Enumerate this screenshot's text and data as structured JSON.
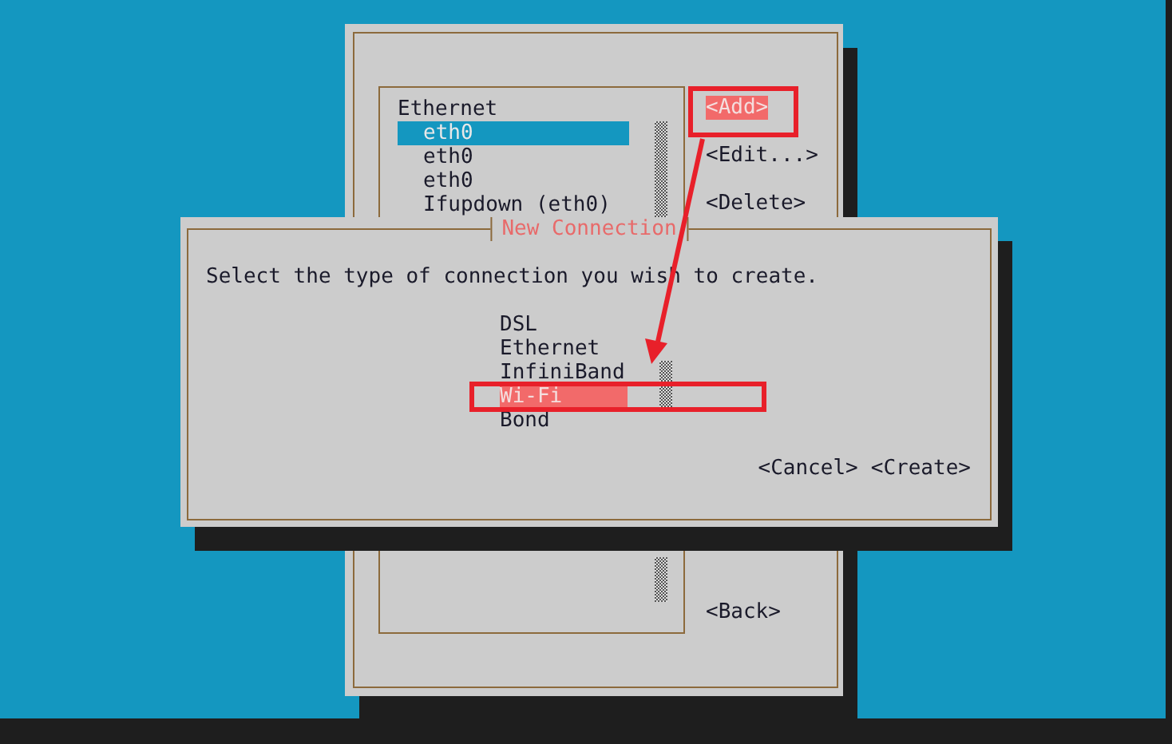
{
  "connections_window": {
    "list": [
      {
        "label": "Ethernet",
        "kind": "header",
        "selected": false
      },
      {
        "label": "eth0",
        "kind": "item",
        "selected": true
      },
      {
        "label": "eth0",
        "kind": "item",
        "selected": false
      },
      {
        "label": "eth0",
        "kind": "item",
        "selected": false
      },
      {
        "label": "Ifupdown (eth0)",
        "kind": "item",
        "selected": false
      }
    ],
    "buttons": [
      {
        "label": "<Add>",
        "focused": true,
        "kind": "action"
      },
      {
        "label": "<Edit...>",
        "focused": false,
        "kind": "action"
      },
      {
        "label": "<Delete>",
        "focused": false,
        "kind": "action"
      },
      {
        "label": "<Back>",
        "focused": false,
        "kind": "back"
      }
    ]
  },
  "new_connection_dialog": {
    "title": "New Connection",
    "prompt": "Select the type of connection you wish to create.",
    "types": [
      {
        "label": "DSL",
        "selected": false
      },
      {
        "label": "Ethernet",
        "selected": false
      },
      {
        "label": "InfiniBand",
        "selected": false
      },
      {
        "label": "Wi-Fi",
        "selected": true
      },
      {
        "label": "Bond",
        "selected": false
      }
    ],
    "buttons": [
      {
        "label": "<Cancel>",
        "focused": false
      },
      {
        "label": "<Create>",
        "focused": false
      }
    ]
  }
}
